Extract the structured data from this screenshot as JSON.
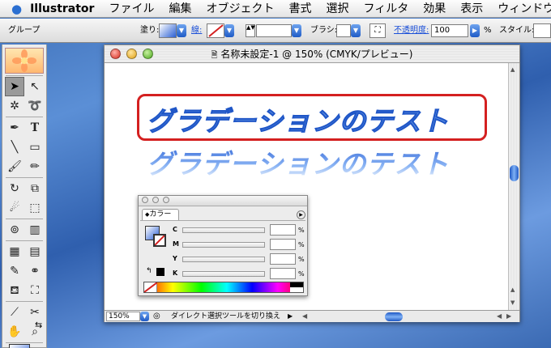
{
  "menubar": {
    "apple": "",
    "app": "Illustrator",
    "items": [
      "ファイル",
      "編集",
      "オブジェクト",
      "書式",
      "選択",
      "フィルタ",
      "効果",
      "表示",
      "ウィンドウ"
    ]
  },
  "control": {
    "group_label": "グループ",
    "fill_label": "塗り:",
    "stroke_label": "線:",
    "brush_label": "ブラシ:",
    "opacity_label": "不透明度:",
    "opacity_value": "100",
    "opacity_unit": "%",
    "style_label": "スタイル:"
  },
  "document": {
    "title": "名称未設定-1 @ 150% (CMYK/プレビュー)",
    "headline": "グラデーションのテスト",
    "zoom": "150%",
    "status_text": "ダイレクト選択ツールを切り換え"
  },
  "color_palette": {
    "title": "カラー",
    "channels": [
      "C",
      "M",
      "Y",
      "K"
    ],
    "unit": "%"
  },
  "colors": {
    "accent": "#1f5bc6",
    "selection": "#d42020",
    "gradient_top": "#2a5fd4"
  }
}
